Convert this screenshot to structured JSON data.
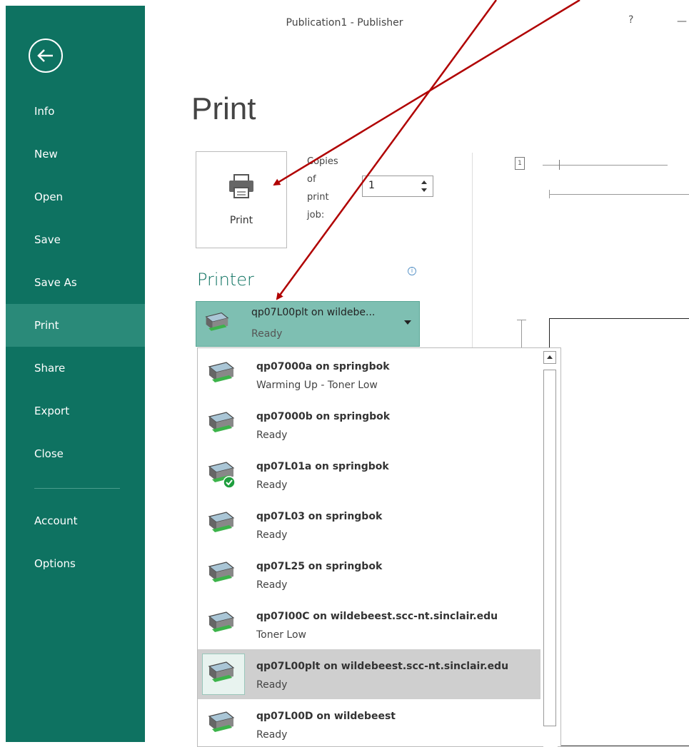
{
  "window": {
    "title": "Publication1 - Publisher",
    "help": "?",
    "minimize": "—"
  },
  "sidebar": {
    "items": [
      {
        "label": "Info"
      },
      {
        "label": "New"
      },
      {
        "label": "Open"
      },
      {
        "label": "Save"
      },
      {
        "label": "Save As"
      },
      {
        "label": "Print",
        "active": true
      },
      {
        "label": "Share"
      },
      {
        "label": "Export"
      },
      {
        "label": "Close"
      },
      {
        "label": "Account"
      },
      {
        "label": "Options"
      }
    ]
  },
  "page": {
    "title": "Print"
  },
  "print_button": {
    "label": "Print"
  },
  "copies": {
    "label_lines": [
      "Copies",
      "of",
      "print",
      "job:"
    ],
    "value": "1"
  },
  "printer_section": {
    "heading": "Printer",
    "selected": {
      "name": "qp07L00plt on wildebe...",
      "status": "Ready"
    }
  },
  "page_number": "1",
  "printer_list": [
    {
      "name": "qp07000a on springbok",
      "status": "Warming Up - Toner Low",
      "default": false
    },
    {
      "name": "qp07000b on springbok",
      "status": "Ready",
      "default": false
    },
    {
      "name": "qp07L01a on springbok",
      "status": "Ready",
      "default": true
    },
    {
      "name": "qp07L03 on springbok",
      "status": "Ready",
      "default": false
    },
    {
      "name": "qp07L25 on springbok",
      "status": "Ready",
      "default": false
    },
    {
      "name": "qp07I00C on wildebeest.scc-nt.sinclair.edu",
      "status": "Toner Low",
      "default": false
    },
    {
      "name": "qp07L00plt on wildebeest.scc-nt.sinclair.edu",
      "status": "Ready",
      "default": false,
      "selected": true
    },
    {
      "name": "qp07L00D on wildebeest",
      "status": "Ready",
      "default": false
    }
  ],
  "colors": {
    "sidebar": "#0e7261",
    "sidebar_active": "#2a8a79",
    "select_bg": "#7ebfb2",
    "arrow": "#b00000",
    "default_check": "#1e9e3e"
  }
}
